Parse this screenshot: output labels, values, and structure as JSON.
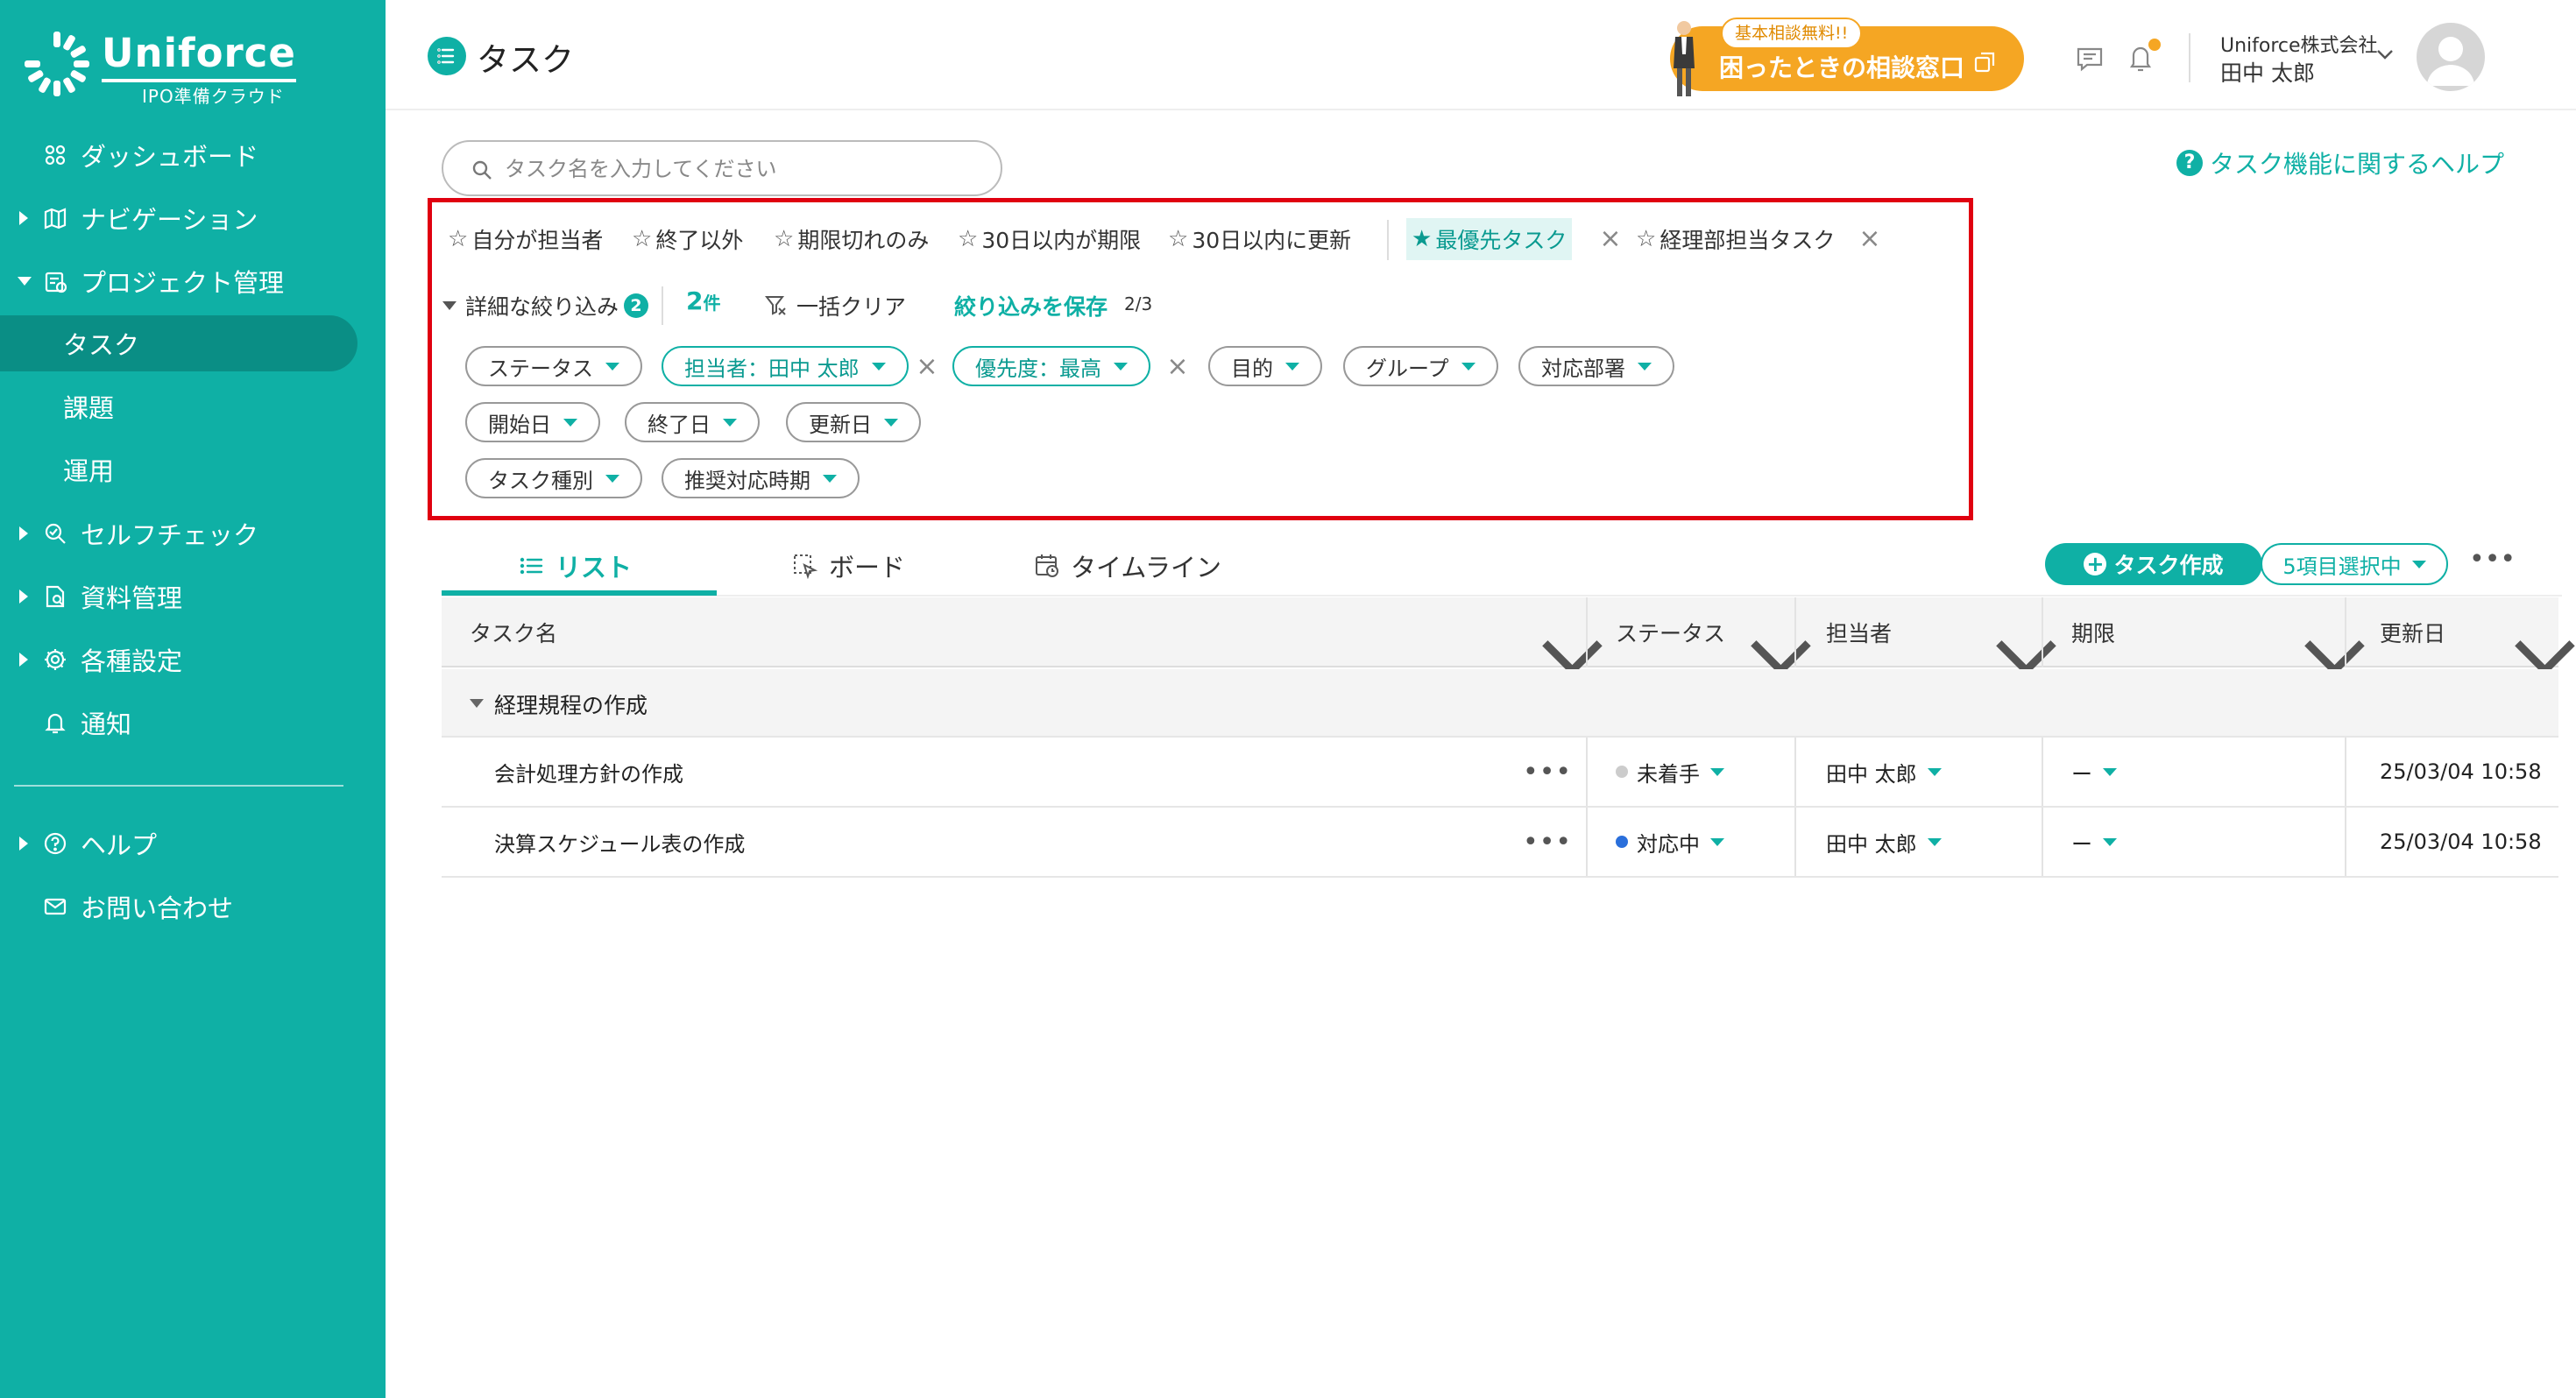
{
  "sidebar": {
    "brand": "Uniforce",
    "brand_sub": "IPO準備クラウド",
    "items": [
      {
        "label": "ダッシュボード"
      },
      {
        "label": "ナビゲーション"
      },
      {
        "label": "プロジェクト管理"
      },
      {
        "label": "タスク"
      },
      {
        "label": "課題"
      },
      {
        "label": "運用"
      },
      {
        "label": "セルフチェック"
      },
      {
        "label": "資料管理"
      },
      {
        "label": "各種設定"
      },
      {
        "label": "通知"
      },
      {
        "label": "ヘルプ"
      },
      {
        "label": "お問い合わせ"
      }
    ]
  },
  "header": {
    "title": "タスク",
    "consult_badge": "基本相談無料!!",
    "consult_label": "困ったときの相談窓口",
    "company": "Uniforce株式会社",
    "user": "田中 太郎"
  },
  "search": {
    "placeholder": "タスク名を入力してください"
  },
  "help_link": "タスク機能に関するヘルプ",
  "filters": {
    "quick": [
      {
        "label": "自分が担当者",
        "star": "☆"
      },
      {
        "label": "終了以外",
        "star": "☆"
      },
      {
        "label": "期限切れのみ",
        "star": "☆"
      },
      {
        "label": "30日以内が期限",
        "star": "☆"
      },
      {
        "label": "30日以内に更新",
        "star": "☆"
      },
      {
        "label": "最優先タスク",
        "star": "★"
      },
      {
        "label": "経理部担当タスク",
        "star": "☆"
      }
    ],
    "advanced_label": "詳細な絞り込み",
    "advanced_count": "2",
    "result_count": "2",
    "result_unit": "件",
    "clear_label": "一括クリア",
    "save_label": "絞り込みを保存",
    "page_info": "2/3",
    "chips": [
      {
        "label": "ステータス"
      },
      {
        "label": "担当者：田中 太郎"
      },
      {
        "label": "優先度：最高"
      },
      {
        "label": "目的"
      },
      {
        "label": "グループ"
      },
      {
        "label": "対応部署"
      },
      {
        "label": "開始日"
      },
      {
        "label": "終了日"
      },
      {
        "label": "更新日"
      },
      {
        "label": "タスク種別"
      },
      {
        "label": "推奨対応時期"
      }
    ]
  },
  "view_tabs": [
    {
      "label": "リスト"
    },
    {
      "label": "ボード"
    },
    {
      "label": "タイムライン"
    }
  ],
  "actions": {
    "create": "タスク作成",
    "selected": "5項目選択中",
    "more": "•••"
  },
  "table": {
    "headers": [
      "タスク名",
      "ステータス",
      "担当者",
      "期限",
      "更新日"
    ],
    "group": "経理規程の作成",
    "rows": [
      {
        "name": "会計処理方針の作成",
        "more": "•••",
        "status": "未着手",
        "status_color": "#cccccc",
        "assignee": "田中 太郎",
        "deadline": "ー",
        "updated": "25/03/04 10:58"
      },
      {
        "name": "決算スケジュール表の作成",
        "more": "•••",
        "status": "対応中",
        "status_color": "#2a6fdb",
        "assignee": "田中 太郎",
        "deadline": "ー",
        "updated": "25/03/04 10:58"
      }
    ]
  },
  "colors": {
    "brand": "#0fb0a5",
    "accent": "#f5a623",
    "highlight": "#e00010"
  }
}
